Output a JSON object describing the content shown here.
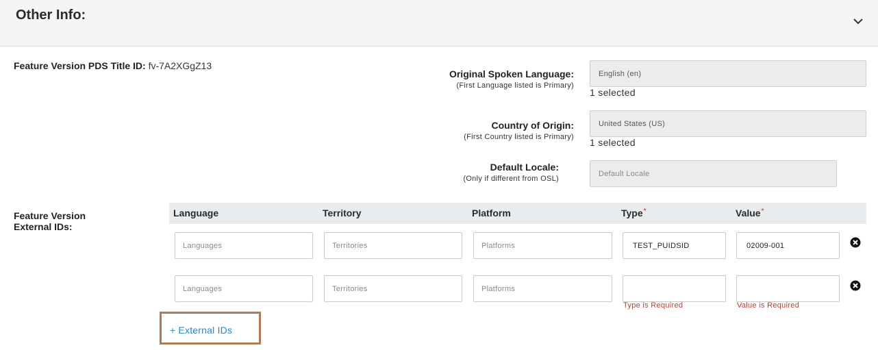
{
  "header": {
    "title": "Other Info:",
    "collapse_icon": "chevron-down-icon"
  },
  "pds": {
    "label": "Feature Version PDS Title ID:",
    "value": "fv-7A2XGgZ13"
  },
  "original_spoken_language": {
    "label": "Original Spoken Language:",
    "hint": "(First Language listed is Primary)",
    "value": "English (en)",
    "selected": "1 selected"
  },
  "country_of_origin": {
    "label": "Country of Origin:",
    "hint": "(First Country listed is Primary)",
    "value": "United States (US)",
    "selected": "1 selected"
  },
  "default_locale": {
    "label": "Default Locale:",
    "hint": "(Only if different from OSL)",
    "placeholder": "Default Locale"
  },
  "external_ids": {
    "label_line1": "Feature Version",
    "label_line2": "External IDs:",
    "columns": {
      "language": "Language",
      "territory": "Territory",
      "platform": "Platform",
      "type": "Type",
      "value": "Value",
      "required_mark": "*"
    },
    "rows": [
      {
        "language_placeholder": "Languages",
        "territory_placeholder": "Territories",
        "platform_placeholder": "Platforms",
        "type": "TEST_PUIDSID",
        "value": "02009-001"
      },
      {
        "language_placeholder": "Languages",
        "territory_placeholder": "Territories",
        "platform_placeholder": "Platforms",
        "type": "",
        "value": "",
        "type_error": "Type is Required",
        "value_error": "Value is Required"
      }
    ],
    "add_label": "+ External IDs"
  },
  "colors": {
    "link": "#2b86c5",
    "error": "#c0392b",
    "highlight": "#b07a56",
    "required": "#d9534f"
  }
}
